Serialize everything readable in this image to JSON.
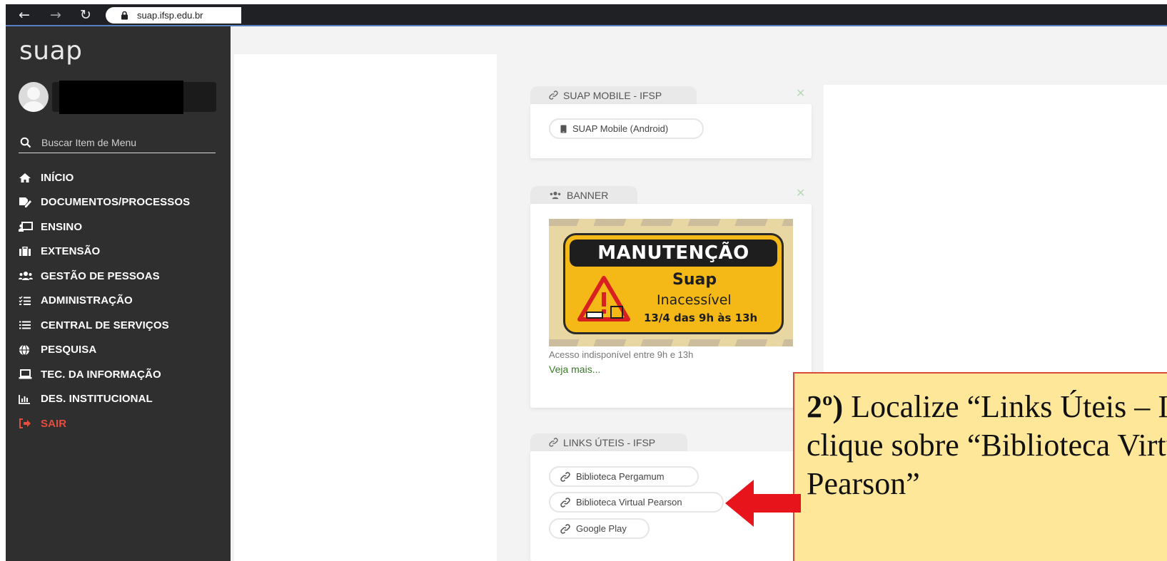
{
  "browser": {
    "url": "suap.ifsp.edu.br",
    "icons": [
      "back-arrow-icon",
      "forward-arrow-icon",
      "reload-icon",
      "lock-icon"
    ]
  },
  "sidebar": {
    "logo": "suap",
    "user_name": "",
    "search_placeholder": "Buscar Item de Menu",
    "menu": [
      {
        "label": "INÍCIO",
        "icon": "home-icon"
      },
      {
        "label": "DOCUMENTOS/PROCESSOS",
        "icon": "file-signature-icon"
      },
      {
        "label": "ENSINO",
        "icon": "chalkboard-teacher-icon"
      },
      {
        "label": "EXTENSÃO",
        "icon": "briefcase-icon"
      },
      {
        "label": "GESTÃO DE PESSOAS",
        "icon": "users-icon"
      },
      {
        "label": "ADMINISTRAÇÃO",
        "icon": "tasks-icon"
      },
      {
        "label": "CENTRAL DE SERVIÇOS",
        "icon": "list-icon"
      },
      {
        "label": "PESQUISA",
        "icon": "globe-icon"
      },
      {
        "label": "TEC. DA INFORMAÇÃO",
        "icon": "laptop-icon"
      },
      {
        "label": "DES. INSTITUCIONAL",
        "icon": "chart-bar-icon"
      },
      {
        "label": "SAIR",
        "icon": "sign-out-icon"
      }
    ],
    "colors": {
      "background": "#2f2f2f",
      "logout": "#e74c3c"
    }
  },
  "widgets": {
    "mobile": {
      "title": "SUAP MOBILE - IFSP",
      "links": [
        "SUAP Mobile (Android)"
      ]
    },
    "banner": {
      "title": "BANNER",
      "image_text": {
        "heading": "MANUTENÇÃO",
        "line1": "Suap",
        "line2": "Inacessível",
        "line3": "13/4 das 9h às 13h"
      },
      "caption": "Acesso indisponível entre 9h e 13h",
      "more_link": "Veja mais..."
    },
    "links": {
      "title": "LINKS ÚTEIS - IFSP",
      "links": [
        "Biblioteca Pergamum",
        "Biblioteca Virtual Pearson",
        "Google Play"
      ]
    },
    "close_symbol": "✕"
  },
  "annotation": {
    "step": "2º)",
    "text": " Localize “Links Úteis – IFSP” e clique sobre “Biblioteca Virtual Pearson”",
    "colors": {
      "background": "#ffe799",
      "arrow": "#e8141c"
    }
  }
}
